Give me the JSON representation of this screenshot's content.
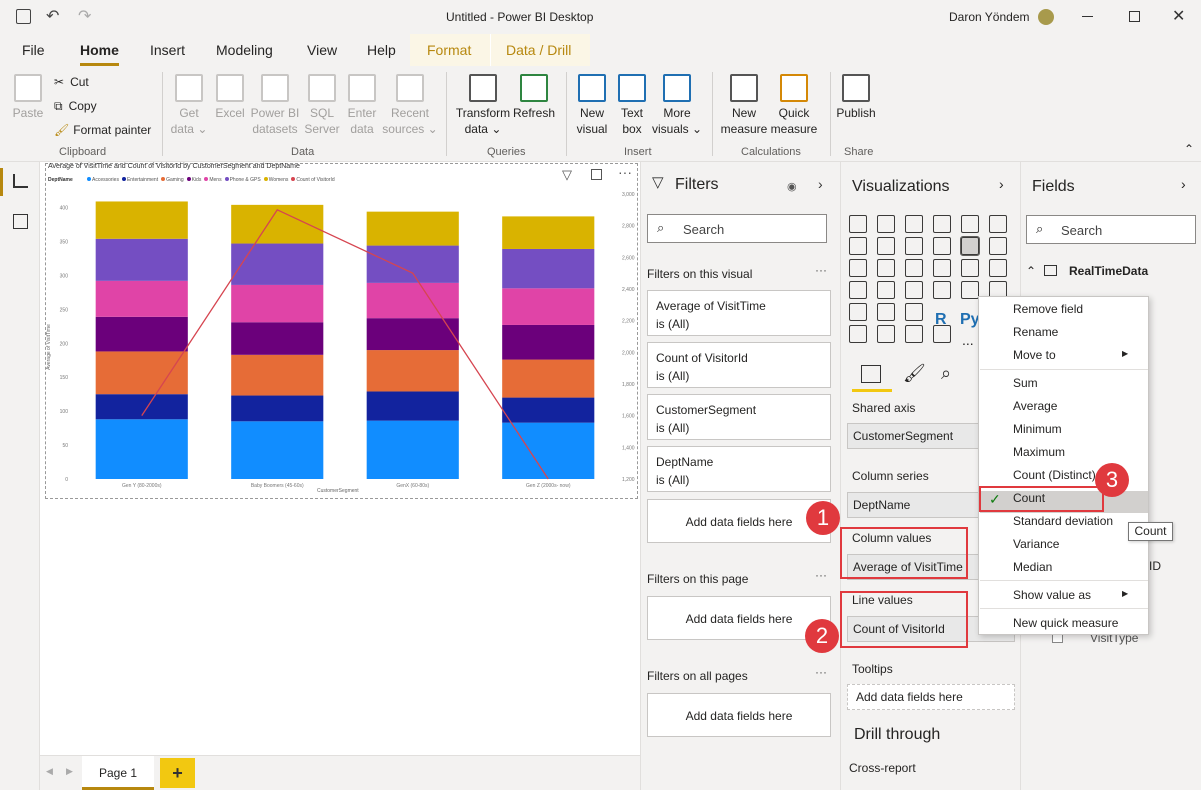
{
  "titlebar": {
    "title": "Untitled - Power BI Desktop",
    "user": "Daron Yöndem",
    "bg": "#f3f2f1"
  },
  "tabs": [
    "File",
    "Home",
    "Insert",
    "Modeling",
    "View",
    "Help",
    "Format",
    "Data / Drill"
  ],
  "ribbon": {
    "clipboard": {
      "paste": "Paste",
      "cut": "Cut",
      "copy": "Copy",
      "format_painter": "Format painter",
      "group": "Clipboard"
    },
    "data": {
      "get_data": [
        "Get",
        "data"
      ],
      "excel": "Excel",
      "powerbi": [
        "Power BI",
        "datasets"
      ],
      "sql": [
        "SQL",
        "Server"
      ],
      "enter": [
        "Enter",
        "data"
      ],
      "recent": [
        "Recent",
        "sources"
      ],
      "group": "Data"
    },
    "queries": {
      "transform": [
        "Transform",
        "data"
      ],
      "refresh": "Refresh",
      "group": "Queries"
    },
    "insert": {
      "new_visual": [
        "New",
        "visual"
      ],
      "text_box": [
        "Text",
        "box"
      ],
      "more": [
        "More",
        "visuals"
      ],
      "group": "Insert"
    },
    "calc": {
      "new_measure": [
        "New",
        "measure"
      ],
      "quick_measure": [
        "Quick",
        "measure"
      ],
      "group": "Calculations"
    },
    "share": {
      "publish": "Publish",
      "group": "Share"
    }
  },
  "chart_data": {
    "type": "bar",
    "title": "Average of VisitTime and Count of VisitorId by CustomerSegment and DeptName",
    "legend_title": "DeptName",
    "legend": [
      "Accessories",
      "Entertainment",
      "Gaming",
      "Kids",
      "Mens",
      "Phone & GPS",
      "Womens",
      "Count of VisitorId"
    ],
    "colors": [
      "#118dff",
      "#12239e",
      "#e66c37",
      "#6b007b",
      "#e044a7",
      "#744ec2",
      "#d9b300",
      "#d64550"
    ],
    "categories": [
      "Gen Y (80-2000s)",
      "Baby Boomers (45-60s)",
      "GenX (60-80s)",
      "Gen Z (2000s- now)"
    ],
    "series": [
      {
        "name": "Accessories",
        "values": [
          88,
          85,
          86,
          83
        ]
      },
      {
        "name": "Entertainment",
        "values": [
          37,
          38,
          43,
          37
        ]
      },
      {
        "name": "Gaming",
        "values": [
          63,
          60,
          61,
          56
        ]
      },
      {
        "name": "Kids",
        "values": [
          51,
          48,
          47,
          51
        ]
      },
      {
        "name": "Mens",
        "values": [
          53,
          55,
          52,
          54
        ]
      },
      {
        "name": "Phone & GPS",
        "values": [
          62,
          61,
          55,
          58
        ]
      },
      {
        "name": "Womens",
        "values": [
          55,
          57,
          50,
          48
        ]
      }
    ],
    "line": {
      "name": "Count of VisitorId",
      "values": [
        1600,
        2900,
        2500,
        1200
      ]
    },
    "xlabel": "CustomerSegment",
    "ylabel": "Average of VisitTime",
    "ylim": [
      0,
      420
    ],
    "y2lim": [
      1200,
      3000
    ],
    "yticks": [
      0,
      50,
      100,
      150,
      200,
      250,
      300,
      350,
      400
    ],
    "y2ticks": [
      "1,200",
      "1,400",
      "1,600",
      "1,800",
      "2,000",
      "2,200",
      "2,400",
      "2,600",
      "2,800",
      "3,000"
    ]
  },
  "page": {
    "tab": "Page 1",
    "add": "+"
  },
  "filters": {
    "title": "Filters",
    "search": "Search",
    "on_visual": "Filters on this visual",
    "cards": [
      [
        "Average of VisitTime",
        "is (All)"
      ],
      [
        "Count of VisitorId",
        "is (All)"
      ],
      [
        "CustomerSegment",
        "is (All)"
      ],
      [
        "DeptName",
        "is (All)"
      ]
    ],
    "add": "Add data fields here",
    "on_page": "Filters on this page",
    "on_all": "Filters on all pages"
  },
  "viz": {
    "title": "Visualizations",
    "shared_axis": "Shared axis",
    "shared_axis_val": "CustomerSegment",
    "column_series": "Column series",
    "column_series_val": "DeptName",
    "column_values": "Column values",
    "column_values_val": "Average of VisitTime",
    "line_values": "Line values",
    "line_values_val": "Count of VisitorId",
    "tooltips": "Tooltips",
    "tooltips_add": "Add data fields here",
    "drill": "Drill through",
    "cross": "Cross-report",
    "r_label": "R",
    "py_label": "Py",
    "more": "..."
  },
  "fields": {
    "title": "Fields",
    "search": "Search",
    "table": "RealTimeData",
    "partial1": "ID",
    "partial2": "VisitType"
  },
  "menu": [
    "Remove field",
    "Rename",
    "Move to",
    "Sum",
    "Average",
    "Minimum",
    "Maximum",
    "Count (Distinct)",
    "Count",
    "Standard deviation",
    "Variance",
    "Median",
    "Show value as",
    "New quick measure"
  ],
  "tooltip": "Count",
  "badges": [
    "1",
    "2",
    "3"
  ]
}
